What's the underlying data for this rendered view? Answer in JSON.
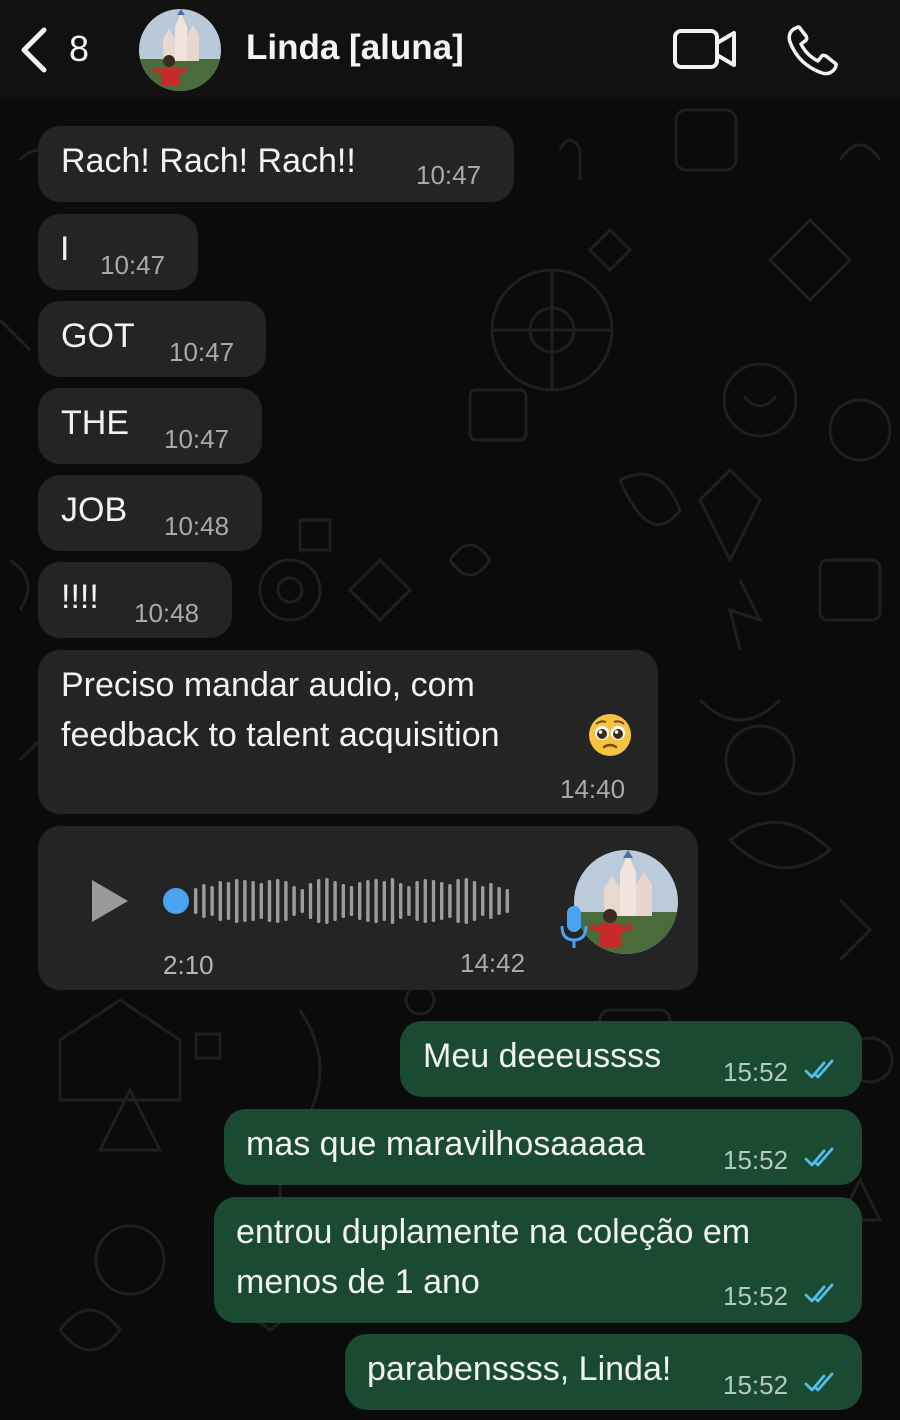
{
  "header": {
    "back_count": "8",
    "contact_name": "Linda [aluna]",
    "icons": [
      "chevron-left-icon",
      "avatar-photo",
      "video-camera-icon",
      "phone-icon"
    ]
  },
  "messages": {
    "m1": {
      "text": "Rach! Rach! Rach!!",
      "time": "10:47",
      "direction": "incoming"
    },
    "m2": {
      "text": "I",
      "time": "10:47",
      "direction": "incoming"
    },
    "m3": {
      "text": "GOT",
      "time": "10:47",
      "direction": "incoming"
    },
    "m4": {
      "text": "THE",
      "time": "10:47",
      "direction": "incoming"
    },
    "m5": {
      "text": "JOB",
      "time": "10:48",
      "direction": "incoming"
    },
    "m6": {
      "text": "!!!!",
      "time": "10:48",
      "direction": "incoming"
    },
    "m7": {
      "line1": "Preciso mandar audio, com",
      "line2": "feedback to talent acquisition",
      "emoji": "pleading-face",
      "time": "14:40",
      "direction": "incoming"
    },
    "audio": {
      "duration": "2:10",
      "time": "14:42",
      "progress": 0.0,
      "direction": "incoming"
    },
    "m8": {
      "text": "Meu deeeussss",
      "time": "15:52",
      "direction": "outgoing",
      "status": "read"
    },
    "m9": {
      "text": "mas que maravilhosaaaaa",
      "time": "15:52",
      "direction": "outgoing",
      "status": "read"
    },
    "m10": {
      "line1": "entrou duplamente na coleção em",
      "line2": "menos de 1 ano",
      "time": "15:52",
      "direction": "outgoing",
      "status": "read"
    },
    "m11": {
      "text": "parabenssss, Linda!",
      "time": "15:52",
      "direction": "outgoing",
      "status": "read"
    }
  },
  "colors": {
    "background": "#0b0b0b",
    "incoming_bubble": "#242424",
    "outgoing_bubble": "#1a4a32",
    "read_ticks": "#53bdeb",
    "audio_dot": "#4aa3f0"
  }
}
